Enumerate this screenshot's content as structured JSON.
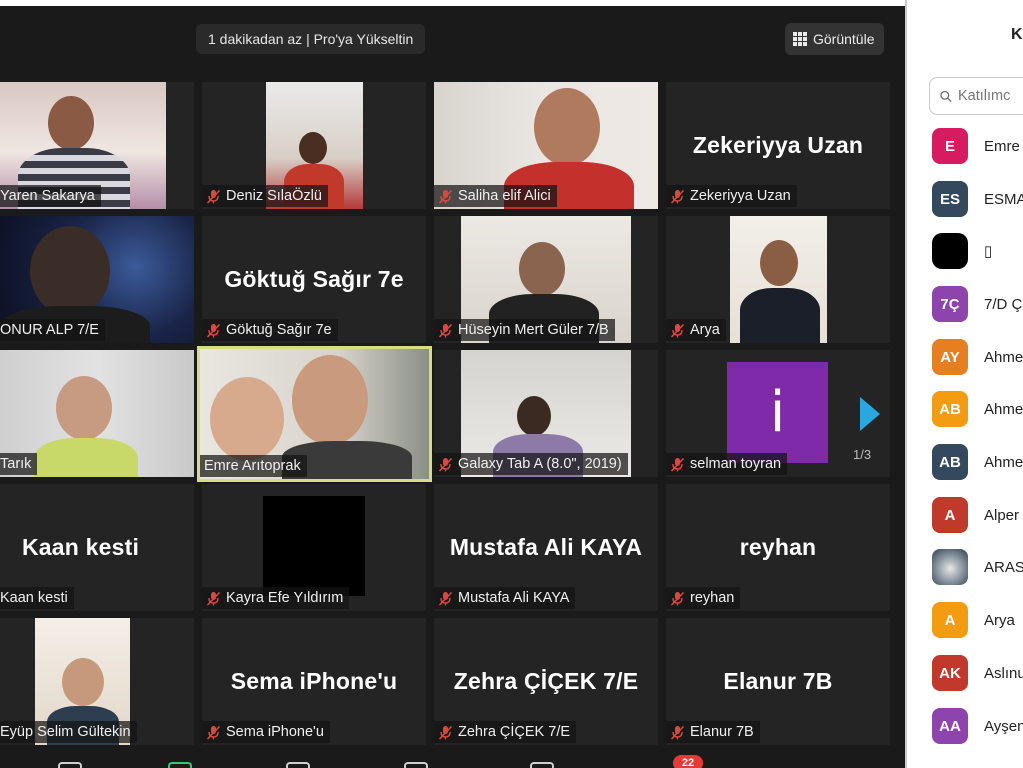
{
  "banner": {
    "upgrade_text": "1 dakikadan az | Pro'ya Yükseltin"
  },
  "view_button": {
    "label": "Görüntüle",
    "icon": "grid-icon"
  },
  "tiles": [
    {
      "name": "Yaren Sakarya",
      "muted": false,
      "video": true
    },
    {
      "name": "Deniz SılaÖzlü",
      "muted": true,
      "video": true
    },
    {
      "name": "Saliha elif Alici",
      "muted": true,
      "video": true
    },
    {
      "name": "Zekeriyya Uzan",
      "muted": true,
      "video": false,
      "display": "Zekeriyya Uzan"
    },
    {
      "name": "ONUR ALP 7/E",
      "muted": false,
      "video": true
    },
    {
      "name": "Göktuğ Sağır 7e",
      "muted": true,
      "video": false,
      "display": "Göktuğ Sağır 7e"
    },
    {
      "name": "Hüseyin Mert Güler 7/B",
      "muted": true,
      "video": true
    },
    {
      "name": "Arya",
      "muted": true,
      "video": true
    },
    {
      "name": "Tarık",
      "muted": false,
      "video": true
    },
    {
      "name": "Emre Arıtoprak",
      "muted": false,
      "video": true,
      "active": true
    },
    {
      "name": "Galaxy Tab A (8.0\", 2019)",
      "muted": true,
      "video": true
    },
    {
      "name": "selman toyran",
      "muted": true,
      "video": true,
      "avatar_letter": "i"
    },
    {
      "name": "Kaan kesti",
      "muted": false,
      "video": false,
      "display": "Kaan kesti"
    },
    {
      "name": "Kayra Efe Yıldırım",
      "muted": true,
      "video": true
    },
    {
      "name": "Mustafa Ali KAYA",
      "muted": true,
      "video": false,
      "display": "Mustafa Ali KAYA"
    },
    {
      "name": "reyhan",
      "muted": true,
      "video": false,
      "display": "reyhan"
    },
    {
      "name": "Eyüp Selim Gültekin",
      "muted": false,
      "video": true
    },
    {
      "name": "Sema iPhone'u",
      "muted": true,
      "video": false,
      "display": "Sema iPhone'u"
    },
    {
      "name": "Zehra ÇİÇEK 7/E",
      "muted": true,
      "video": false,
      "display": "Zehra ÇİÇEK 7/E"
    },
    {
      "name": "Elanur 7B",
      "muted": true,
      "video": false,
      "display": "Elanur 7B"
    }
  ],
  "pagination": {
    "indicator": "1/3"
  },
  "toolbar": {
    "chat_badge": "22"
  },
  "side_panel": {
    "title": "K",
    "search_placeholder": "Katılımc",
    "participants": [
      {
        "initials": "E",
        "name": "Emre",
        "color": "#d81b60"
      },
      {
        "initials": "ES",
        "name": "ESMA",
        "color": "#34495e"
      },
      {
        "initials": "",
        "name": "▯",
        "color": "#000000"
      },
      {
        "initials": "7Ç",
        "name": "7/D Ç",
        "color": "#8e44ad"
      },
      {
        "initials": "AY",
        "name": "Ahme",
        "color": "#e67e22"
      },
      {
        "initials": "AB",
        "name": "Ahme",
        "color": "#f39c12"
      },
      {
        "initials": "AB",
        "name": "Ahme",
        "color": "#34495e"
      },
      {
        "initials": "A",
        "name": "Alper",
        "color": "#c0392b"
      },
      {
        "initials": "",
        "name": "ARAS",
        "color": "#5d6d7e",
        "photo": true
      },
      {
        "initials": "A",
        "name": "Arya",
        "color": "#f39c12"
      },
      {
        "initials": "AK",
        "name": "Aslınu",
        "color": "#c0392b"
      },
      {
        "initials": "AA",
        "name": "Ayşen",
        "color": "#8e44ad"
      }
    ]
  }
}
